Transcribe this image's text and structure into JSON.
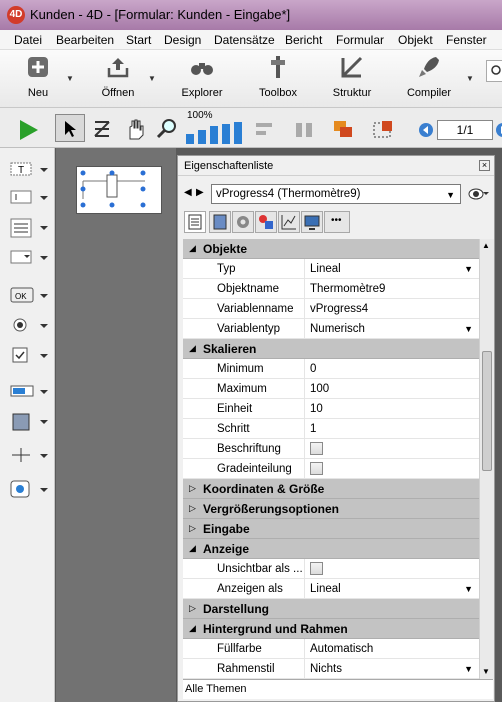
{
  "window": {
    "title": "Kunden - 4D - [Formular: Kunden -  Eingabe*]"
  },
  "menu": [
    "Datei",
    "Bearbeiten",
    "Start",
    "Design",
    "Datensätze",
    "Bericht",
    "Formular",
    "Objekt",
    "Fenster"
  ],
  "toolbar": {
    "neu": "Neu",
    "oeffnen": "Öffnen",
    "explorer": "Explorer",
    "toolbox": "Toolbox",
    "struktur": "Struktur",
    "compiler": "Compiler"
  },
  "toolbar2": {
    "zoom": "100%",
    "page": "1/1"
  },
  "props": {
    "title": "Eigenschaftenliste",
    "selected_object": "vProgress4 (Thermomètre9)",
    "footer": "Alle Themen",
    "rows": [
      {
        "type": "section",
        "open": true,
        "label": "Objekte"
      },
      {
        "type": "prop",
        "key": "Typ",
        "value": "Lineal",
        "dropdown": true
      },
      {
        "type": "prop",
        "key": "Objektname",
        "value": "Thermomètre9"
      },
      {
        "type": "prop",
        "key": "Variablenname",
        "value": "vProgress4"
      },
      {
        "type": "prop",
        "key": "Variablentyp",
        "value": "Numerisch",
        "dropdown": true
      },
      {
        "type": "section",
        "open": true,
        "label": "Skalieren"
      },
      {
        "type": "prop",
        "key": "Minimum",
        "value": "0"
      },
      {
        "type": "prop",
        "key": "Maximum",
        "value": "100"
      },
      {
        "type": "prop",
        "key": "Einheit",
        "value": "10"
      },
      {
        "type": "prop",
        "key": "Schritt",
        "value": "1"
      },
      {
        "type": "check",
        "key": "Beschriftung"
      },
      {
        "type": "check",
        "key": "Gradeinteilung"
      },
      {
        "type": "section",
        "open": false,
        "label": "Koordinaten & Größe"
      },
      {
        "type": "section",
        "open": false,
        "label": "Vergrößerungsoptionen"
      },
      {
        "type": "section",
        "open": false,
        "label": "Eingabe"
      },
      {
        "type": "section",
        "open": true,
        "label": "Anzeige"
      },
      {
        "type": "check",
        "key": "Unsichtbar als ..."
      },
      {
        "type": "prop",
        "key": "Anzeigen als",
        "value": "Lineal",
        "dropdown": true
      },
      {
        "type": "section",
        "open": false,
        "label": "Darstellung"
      },
      {
        "type": "section",
        "open": true,
        "label": "Hintergrund und Rahmen"
      },
      {
        "type": "prop",
        "key": "Füllfarbe",
        "value": "Automatisch"
      },
      {
        "type": "prop",
        "key": "Rahmenstil",
        "value": "Nichts",
        "dropdown": true
      }
    ]
  }
}
